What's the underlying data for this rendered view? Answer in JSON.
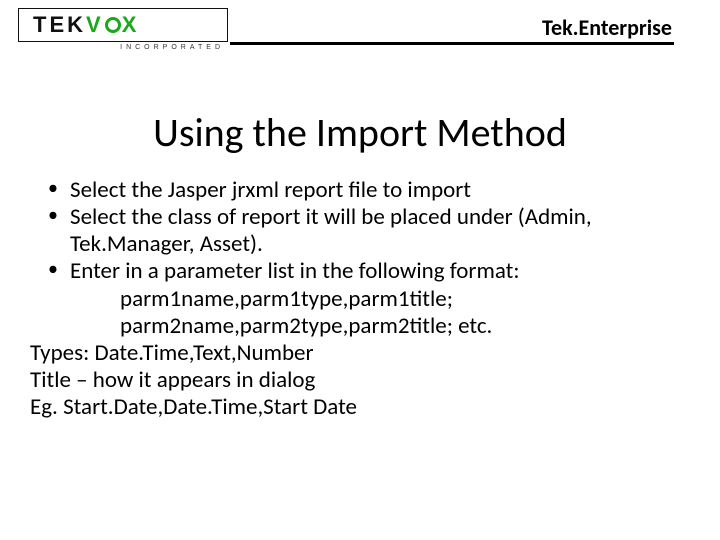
{
  "header": {
    "logo_main": "TEKVOX",
    "logo_sub": "INCORPORATED",
    "product": "Tek.Enterprise"
  },
  "title": "Using the Import Method",
  "bullets": [
    "Select the Jasper jrxml report file to import",
    "Select the class of report it will be placed under (Admin, Tek.Manager, Asset).",
    "Enter in a parameter list in the following format:"
  ],
  "subs": [
    "parm1name,parm1type,parm1title;",
    "parm2name,parm2type,parm2title; etc."
  ],
  "lines": [
    "Types: Date.Time,Text,Number",
    "Title – how it appears in dialog",
    "Eg. Start.Date,Date.Time,Start Date"
  ]
}
